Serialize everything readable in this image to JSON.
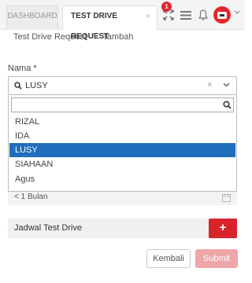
{
  "tabs": [
    {
      "label": "DASHBOARD"
    },
    {
      "label": "TEST DRIVE REQUEST",
      "close": "×"
    }
  ],
  "header": {
    "notification_count": "1"
  },
  "breadcrumb": {
    "parent": "Test Drive Request",
    "separator": ">",
    "current": "Tambah"
  },
  "form": {
    "nama_label": "Nama *",
    "nama_value": "LUSY",
    "nama_clear": "×",
    "search_value": "",
    "options": [
      "RIZAL",
      "IDA",
      "LUSY",
      "SIAHAAN",
      "Agus"
    ],
    "selected_option": "LUSY",
    "period_value": "< 1 Bulan",
    "jadwal_label": "Jadwal Test Drive",
    "add_label": "+"
  },
  "actions": {
    "back_label": "Kembali",
    "submit_label": "Submit"
  },
  "colors": {
    "accent": "#d9232a",
    "selected": "#1f6ebb",
    "submit_disabled": "#eea6a8"
  }
}
